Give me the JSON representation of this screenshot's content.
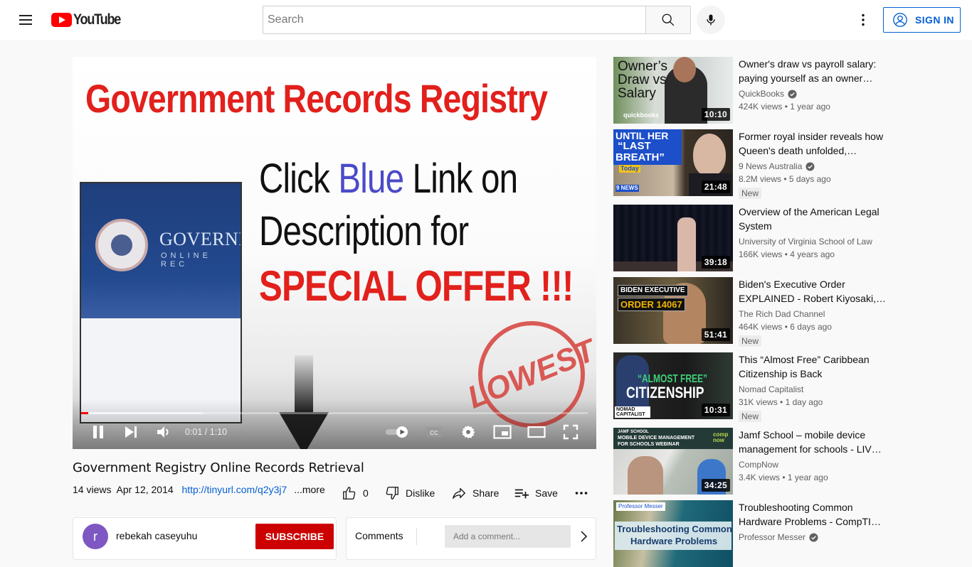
{
  "header": {
    "logo_text": "YouTube",
    "search_placeholder": "Search",
    "signin_label": "SIGN IN",
    "icons": [
      "menu-icon",
      "search-icon",
      "mic-icon",
      "more-vert-icon",
      "account-icon"
    ]
  },
  "player": {
    "frame_text": {
      "headline": "Government Records Registry",
      "line1_a": "Click ",
      "line1_blue": "Blue",
      "line1_b": " Link on",
      "line2": "Description for",
      "line3": "SPECIAL OFFER !!!",
      "site_title": "GOVERNM",
      "site_subtitle": "ONLINE REC",
      "stamp": "LOWEST"
    },
    "time_current": "0:01",
    "time_total": "1:10",
    "time_display": "0:01 / 1:10",
    "progress_played_fraction": 0.014,
    "progress_buffered_fraction": 0.24,
    "controls": [
      "pause",
      "next",
      "volume",
      "autoplay-toggle",
      "captions",
      "settings",
      "miniplayer",
      "theater",
      "fullscreen"
    ]
  },
  "video": {
    "title": "Government Registry Online Records Retrieval",
    "views": "14 views",
    "date": "Apr 12, 2014",
    "link": "http://tinyurl.com/q2y3j7",
    "more_label": "...more",
    "likes": "0",
    "dislike_label": "Dislike",
    "share_label": "Share",
    "save_label": "Save"
  },
  "owner": {
    "avatar_letter": "r",
    "avatar_color": "#7e57c2",
    "name": "rebekah caseyuhu",
    "subscribe_label": "SUBSCRIBE"
  },
  "comments": {
    "label": "Comments",
    "placeholder": "Add a comment..."
  },
  "recommendations": [
    {
      "title": "Owner's draw vs payroll salary: paying yourself as an owner…",
      "channel": "QuickBooks",
      "verified": true,
      "views": "424K views",
      "age": "1 year ago",
      "duration": "10:10",
      "new": false
    },
    {
      "title": "Former royal insider reveals how Queen's death unfolded,…",
      "channel": "9 News Australia",
      "verified": true,
      "views": "8.2M views",
      "age": "5 days ago",
      "duration": "21:48",
      "new": true
    },
    {
      "title": "Overview of the American Legal System",
      "channel": "University of Virginia School of Law",
      "verified": false,
      "views": "166K views",
      "age": "4 years ago",
      "duration": "39:18",
      "new": false
    },
    {
      "title": "Biden's Executive Order EXPLAINED - Robert Kiyosaki,…",
      "channel": "The Rich Dad Channel",
      "verified": false,
      "views": "464K views",
      "age": "6 days ago",
      "duration": "51:41",
      "new": true
    },
    {
      "title": "This “Almost Free” Caribbean Citizenship is Back",
      "channel": "Nomad Capitalist",
      "verified": false,
      "views": "31K views",
      "age": "1 day ago",
      "duration": "10:31",
      "new": true
    },
    {
      "title": "Jamf School – mobile device management for schools - LIV…",
      "channel": "CompNow",
      "verified": false,
      "views": "3.4K views",
      "age": "1 year ago",
      "duration": "34:25",
      "new": false
    },
    {
      "title": "Troubleshooting Common Hardware Problems - CompTI…",
      "channel": "Professor Messer",
      "verified": true,
      "views": "",
      "age": "",
      "duration": "",
      "new": false
    }
  ],
  "new_badge_label": "New",
  "separator": "•",
  "thumb_text": {
    "t0": [
      "Owner’s",
      "Draw vs",
      "Salary",
      "quickbooks"
    ],
    "t1": [
      "UNTIL HER",
      "“LAST",
      "BREATH”",
      "Today",
      "9 NEWS"
    ],
    "t3": [
      "BIDEN EXECUTIVE",
      "ORDER 14067"
    ],
    "t4": [
      "“ALMOST FREE”",
      "CITIZENSHIP",
      "NOMAD CAPITALIST"
    ],
    "t5": [
      "JAMF SCHOOL",
      "MOBILE DEVICE MANAGEMENT",
      "FOR SCHOOLS WEBINAR",
      "comp now"
    ],
    "t6": [
      "Professor Messer",
      "Troubleshooting Common",
      "Hardware Problems"
    ]
  },
  "colors": {
    "brand_red": "#ff0000",
    "subscribe_red": "#cc0000",
    "link_blue": "#065fd4"
  }
}
